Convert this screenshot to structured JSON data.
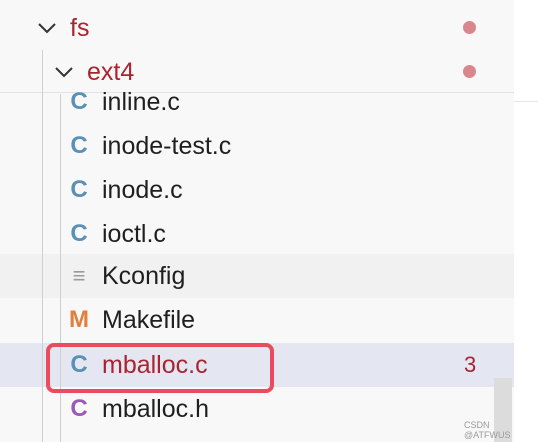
{
  "explorer": {
    "folders": [
      {
        "label": "fs"
      },
      {
        "label": "ext4"
      }
    ],
    "files": [
      {
        "label": "inline.c",
        "icon": "C",
        "icon_name": "c-file-icon"
      },
      {
        "label": "inode-test.c",
        "icon": "C",
        "icon_name": "c-file-icon"
      },
      {
        "label": "inode.c",
        "icon": "C",
        "icon_name": "c-file-icon"
      },
      {
        "label": "ioctl.c",
        "icon": "C",
        "icon_name": "c-file-icon"
      },
      {
        "label": "Kconfig",
        "icon": "≡",
        "icon_name": "text-file-icon"
      },
      {
        "label": "Makefile",
        "icon": "M",
        "icon_name": "makefile-icon"
      },
      {
        "label": "mballoc.c",
        "icon": "C",
        "icon_name": "c-file-icon",
        "problems": "3",
        "selected": true
      },
      {
        "label": "mballoc.h",
        "icon": "C",
        "icon_name": "c-header-icon"
      }
    ]
  },
  "watermark": "CSDN @ATFWUS",
  "colors": {
    "modified": "#a8242f",
    "dot": "#d9878c",
    "c_icon": "#5a8fb6",
    "h_icon": "#9b59b6",
    "makefile_icon": "#e0803c",
    "highlight": "#e84c5e",
    "selection": "#e4e6f1"
  }
}
